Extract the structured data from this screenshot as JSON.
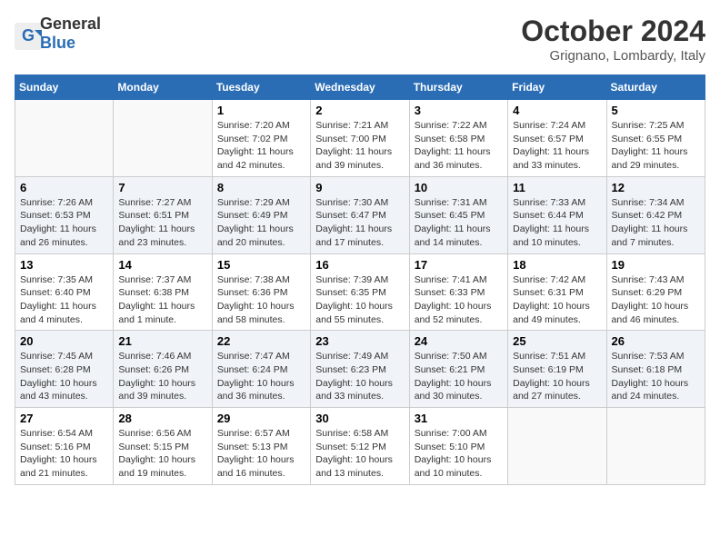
{
  "header": {
    "logo_general": "General",
    "logo_blue": "Blue",
    "month_title": "October 2024",
    "location": "Grignano, Lombardy, Italy"
  },
  "weekdays": [
    "Sunday",
    "Monday",
    "Tuesday",
    "Wednesday",
    "Thursday",
    "Friday",
    "Saturday"
  ],
  "weeks": [
    [
      {
        "day": "",
        "info": ""
      },
      {
        "day": "",
        "info": ""
      },
      {
        "day": "1",
        "info": "Sunrise: 7:20 AM\nSunset: 7:02 PM\nDaylight: 11 hours and 42 minutes."
      },
      {
        "day": "2",
        "info": "Sunrise: 7:21 AM\nSunset: 7:00 PM\nDaylight: 11 hours and 39 minutes."
      },
      {
        "day": "3",
        "info": "Sunrise: 7:22 AM\nSunset: 6:58 PM\nDaylight: 11 hours and 36 minutes."
      },
      {
        "day": "4",
        "info": "Sunrise: 7:24 AM\nSunset: 6:57 PM\nDaylight: 11 hours and 33 minutes."
      },
      {
        "day": "5",
        "info": "Sunrise: 7:25 AM\nSunset: 6:55 PM\nDaylight: 11 hours and 29 minutes."
      }
    ],
    [
      {
        "day": "6",
        "info": "Sunrise: 7:26 AM\nSunset: 6:53 PM\nDaylight: 11 hours and 26 minutes."
      },
      {
        "day": "7",
        "info": "Sunrise: 7:27 AM\nSunset: 6:51 PM\nDaylight: 11 hours and 23 minutes."
      },
      {
        "day": "8",
        "info": "Sunrise: 7:29 AM\nSunset: 6:49 PM\nDaylight: 11 hours and 20 minutes."
      },
      {
        "day": "9",
        "info": "Sunrise: 7:30 AM\nSunset: 6:47 PM\nDaylight: 11 hours and 17 minutes."
      },
      {
        "day": "10",
        "info": "Sunrise: 7:31 AM\nSunset: 6:45 PM\nDaylight: 11 hours and 14 minutes."
      },
      {
        "day": "11",
        "info": "Sunrise: 7:33 AM\nSunset: 6:44 PM\nDaylight: 11 hours and 10 minutes."
      },
      {
        "day": "12",
        "info": "Sunrise: 7:34 AM\nSunset: 6:42 PM\nDaylight: 11 hours and 7 minutes."
      }
    ],
    [
      {
        "day": "13",
        "info": "Sunrise: 7:35 AM\nSunset: 6:40 PM\nDaylight: 11 hours and 4 minutes."
      },
      {
        "day": "14",
        "info": "Sunrise: 7:37 AM\nSunset: 6:38 PM\nDaylight: 11 hours and 1 minute."
      },
      {
        "day": "15",
        "info": "Sunrise: 7:38 AM\nSunset: 6:36 PM\nDaylight: 10 hours and 58 minutes."
      },
      {
        "day": "16",
        "info": "Sunrise: 7:39 AM\nSunset: 6:35 PM\nDaylight: 10 hours and 55 minutes."
      },
      {
        "day": "17",
        "info": "Sunrise: 7:41 AM\nSunset: 6:33 PM\nDaylight: 10 hours and 52 minutes."
      },
      {
        "day": "18",
        "info": "Sunrise: 7:42 AM\nSunset: 6:31 PM\nDaylight: 10 hours and 49 minutes."
      },
      {
        "day": "19",
        "info": "Sunrise: 7:43 AM\nSunset: 6:29 PM\nDaylight: 10 hours and 46 minutes."
      }
    ],
    [
      {
        "day": "20",
        "info": "Sunrise: 7:45 AM\nSunset: 6:28 PM\nDaylight: 10 hours and 43 minutes."
      },
      {
        "day": "21",
        "info": "Sunrise: 7:46 AM\nSunset: 6:26 PM\nDaylight: 10 hours and 39 minutes."
      },
      {
        "day": "22",
        "info": "Sunrise: 7:47 AM\nSunset: 6:24 PM\nDaylight: 10 hours and 36 minutes."
      },
      {
        "day": "23",
        "info": "Sunrise: 7:49 AM\nSunset: 6:23 PM\nDaylight: 10 hours and 33 minutes."
      },
      {
        "day": "24",
        "info": "Sunrise: 7:50 AM\nSunset: 6:21 PM\nDaylight: 10 hours and 30 minutes."
      },
      {
        "day": "25",
        "info": "Sunrise: 7:51 AM\nSunset: 6:19 PM\nDaylight: 10 hours and 27 minutes."
      },
      {
        "day": "26",
        "info": "Sunrise: 7:53 AM\nSunset: 6:18 PM\nDaylight: 10 hours and 24 minutes."
      }
    ],
    [
      {
        "day": "27",
        "info": "Sunrise: 6:54 AM\nSunset: 5:16 PM\nDaylight: 10 hours and 21 minutes."
      },
      {
        "day": "28",
        "info": "Sunrise: 6:56 AM\nSunset: 5:15 PM\nDaylight: 10 hours and 19 minutes."
      },
      {
        "day": "29",
        "info": "Sunrise: 6:57 AM\nSunset: 5:13 PM\nDaylight: 10 hours and 16 minutes."
      },
      {
        "day": "30",
        "info": "Sunrise: 6:58 AM\nSunset: 5:12 PM\nDaylight: 10 hours and 13 minutes."
      },
      {
        "day": "31",
        "info": "Sunrise: 7:00 AM\nSunset: 5:10 PM\nDaylight: 10 hours and 10 minutes."
      },
      {
        "day": "",
        "info": ""
      },
      {
        "day": "",
        "info": ""
      }
    ]
  ]
}
